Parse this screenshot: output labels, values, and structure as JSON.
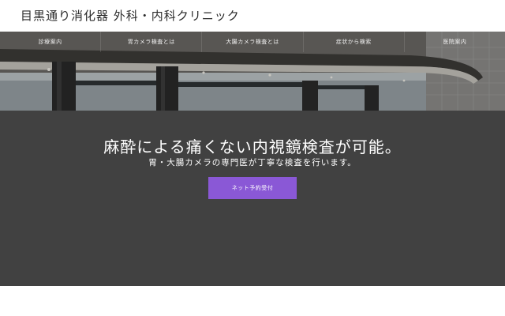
{
  "header": {
    "site_title": "目黒通り消化器 外科・内科クリニック"
  },
  "nav": {
    "items": [
      {
        "label": "診療案内"
      },
      {
        "label": "胃カメラ検査とは"
      },
      {
        "label": "大腸カメラ検査とは"
      },
      {
        "label": "症状から検索"
      },
      {
        "label": "医院案内"
      }
    ]
  },
  "hero": {
    "headline": "麻酔による痛くない内視鏡検査が可能。",
    "subheadline": "胃・大腸カメラの専門医が丁寧な検査を行います。",
    "cta_label": "ネット予約受付"
  },
  "colors": {
    "hero_background": "#414141",
    "cta_background": "#8a58d6",
    "title_text": "#2b2b2b"
  }
}
